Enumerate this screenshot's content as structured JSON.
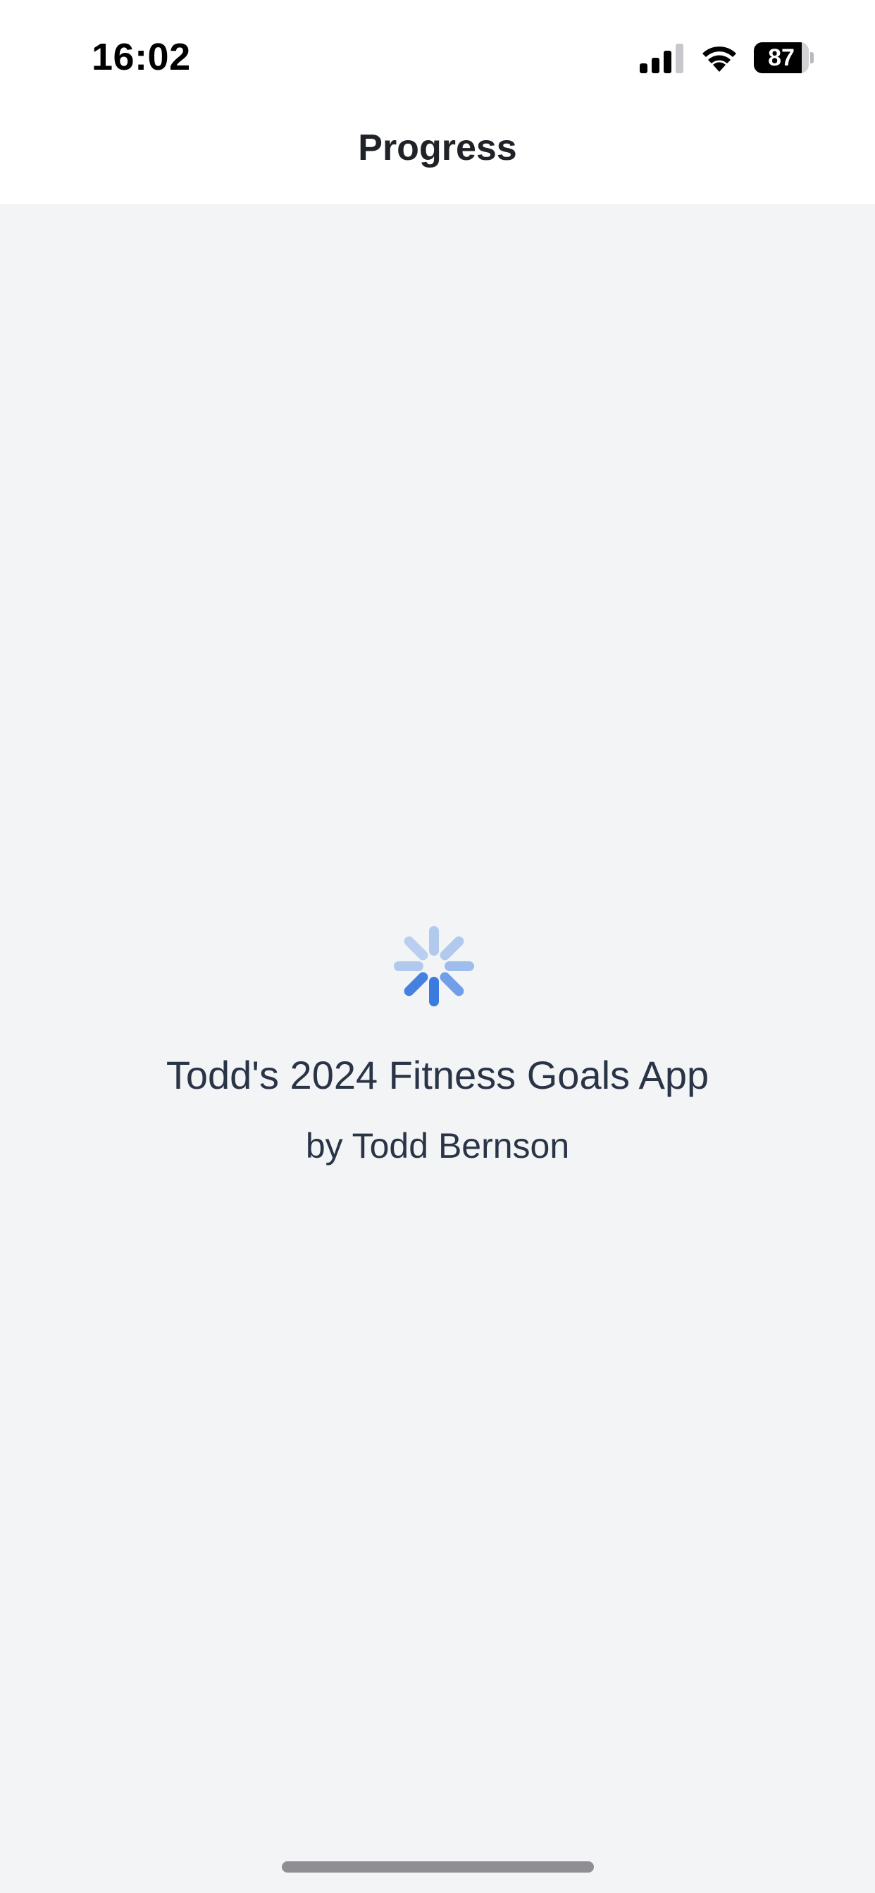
{
  "status_bar": {
    "time": "16:02",
    "battery_level": "87",
    "battery_fraction": 0.87,
    "signal_icon": "cellular-signal-icon",
    "wifi_icon": "wifi-icon"
  },
  "nav": {
    "title": "Progress"
  },
  "loading": {
    "indicator_icon": "loading-spinner-icon",
    "app_title": "Todd's 2024 Fitness Goals App",
    "author": "by Todd Bernson",
    "accent_color": "#3b7be0"
  }
}
